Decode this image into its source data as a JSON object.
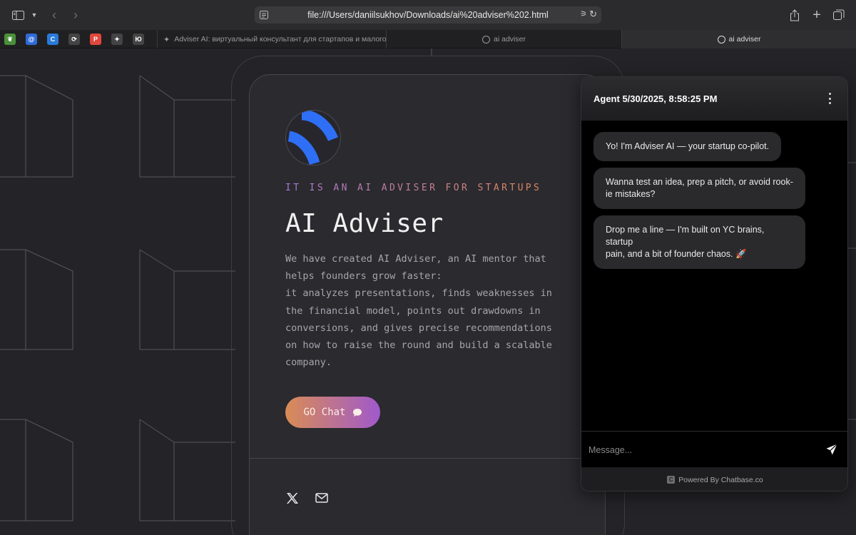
{
  "browser": {
    "url": "file:///Users/daniilsukhov/Downloads/ai%20adviser%202.html",
    "tabs": [
      {
        "label": "Adviser AI: виртуальный консультант для стартапов и малого б..."
      },
      {
        "label": "ai adviser"
      },
      {
        "label": "ai adviser"
      }
    ],
    "favorites": [
      {
        "icon": "leaf-icon",
        "color": "#4a8f3a",
        "glyph": "❦"
      },
      {
        "icon": "at-icon",
        "color": "#2f6bd8",
        "glyph": "@"
      },
      {
        "icon": "c-icon",
        "color": "#2a7ad9",
        "glyph": "C"
      },
      {
        "icon": "sync-icon",
        "color": "#444",
        "glyph": "⟳"
      },
      {
        "icon": "p-icon",
        "color": "#e2473c",
        "glyph": "P"
      },
      {
        "icon": "sparkle-icon",
        "color": "#444",
        "glyph": "✦"
      },
      {
        "icon": "yc-icon",
        "color": "#444",
        "glyph": "Ю"
      }
    ]
  },
  "hero": {
    "kicker": "IT IS AN AI ADVISER FOR STARTUPS",
    "title": "AI Adviser",
    "description_lines": [
      "We have created AI Adviser, an AI mentor that",
      "helps founders grow faster:",
      "it analyzes presentations, finds weaknesses in",
      "the financial model, points out drawdowns in",
      "conversions, and gives precise recommendations",
      "on how to raise the round and build a scalable",
      "company."
    ],
    "cta_label": "GO Chat"
  },
  "chat": {
    "header": "Agent 5/30/2025, 8:58:25 PM",
    "messages": [
      {
        "lines": [
          "Yo! I'm Adviser AI — your startup co-pilot."
        ]
      },
      {
        "lines": [
          "Wanna test an idea, prep a pitch, or avoid rook-",
          "ie mistakes?"
        ]
      },
      {
        "lines": [
          "Drop me a line — I'm built on YC brains, startup",
          "pain, and a bit of founder chaos. 🚀"
        ]
      }
    ],
    "input_placeholder": "Message...",
    "footer": "Powered By Chatbase.co"
  },
  "colors": {
    "background": "#242428",
    "card": "#2a2a2f",
    "accent_blue": "#2f6ff6",
    "gradient_start": "#d98c55",
    "gradient_end": "#a059cc"
  }
}
